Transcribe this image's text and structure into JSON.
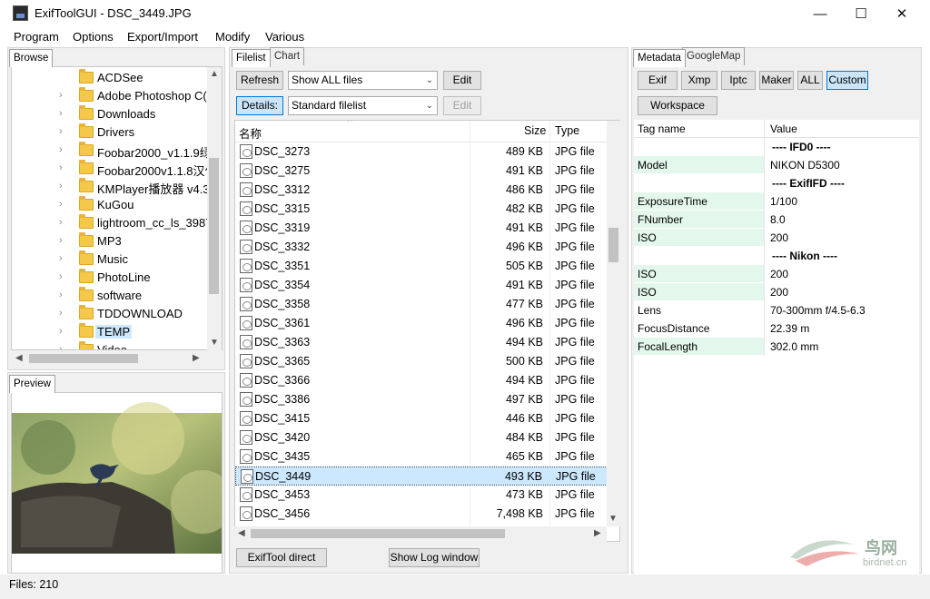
{
  "window": {
    "title": "ExifToolGUI - DSC_3449.JPG",
    "minimize": "—",
    "maximize": "☐",
    "close": "✕"
  },
  "menu": [
    "Program",
    "Options",
    "Export/Import",
    "Modify",
    "Various"
  ],
  "left": {
    "browse_tab": "Browse",
    "preview_tab": "Preview",
    "folders": [
      {
        "name": "ACDSee",
        "expander": false
      },
      {
        "name": "Adobe Photoshop C(",
        "expander": true
      },
      {
        "name": "Downloads",
        "expander": true
      },
      {
        "name": "Drivers",
        "expander": true
      },
      {
        "name": "Foobar2000_v1.1.9绿",
        "expander": true
      },
      {
        "name": "Foobar2000v1.1.8汉化",
        "expander": true
      },
      {
        "name": "KMPlayer播放器 v4.3.",
        "expander": true
      },
      {
        "name": "KuGou",
        "expander": true
      },
      {
        "name": "lightroom_cc_ls_3987",
        "expander": true
      },
      {
        "name": "MP3",
        "expander": true
      },
      {
        "name": "Music",
        "expander": true
      },
      {
        "name": "PhotoLine",
        "expander": true
      },
      {
        "name": "software",
        "expander": true
      },
      {
        "name": "TDDOWNLOAD",
        "expander": true
      },
      {
        "name": "TEMP",
        "expander": true,
        "selected": true
      },
      {
        "name": "Video",
        "expander": true
      }
    ]
  },
  "center": {
    "tabs": [
      "Filelist",
      "Chart"
    ],
    "refresh": "Refresh",
    "filter": "Show ALL files",
    "edit1": "Edit",
    "details": "Details:",
    "view": "Standard filelist",
    "edit2": "Edit",
    "columns": {
      "name": "名称",
      "size": "Size",
      "type": "Type"
    },
    "files": [
      {
        "name": "DSC_3273",
        "size": "489 KB",
        "type": "JPG file"
      },
      {
        "name": "DSC_3275",
        "size": "491 KB",
        "type": "JPG file"
      },
      {
        "name": "DSC_3312",
        "size": "486 KB",
        "type": "JPG file"
      },
      {
        "name": "DSC_3315",
        "size": "482 KB",
        "type": "JPG file"
      },
      {
        "name": "DSC_3319",
        "size": "491 KB",
        "type": "JPG file"
      },
      {
        "name": "DSC_3332",
        "size": "496 KB",
        "type": "JPG file"
      },
      {
        "name": "DSC_3351",
        "size": "505 KB",
        "type": "JPG file"
      },
      {
        "name": "DSC_3354",
        "size": "491 KB",
        "type": "JPG file"
      },
      {
        "name": "DSC_3358",
        "size": "477 KB",
        "type": "JPG file"
      },
      {
        "name": "DSC_3361",
        "size": "496 KB",
        "type": "JPG file"
      },
      {
        "name": "DSC_3363",
        "size": "494 KB",
        "type": "JPG file"
      },
      {
        "name": "DSC_3365",
        "size": "500 KB",
        "type": "JPG file"
      },
      {
        "name": "DSC_3366",
        "size": "494 KB",
        "type": "JPG file"
      },
      {
        "name": "DSC_3386",
        "size": "497 KB",
        "type": "JPG file"
      },
      {
        "name": "DSC_3415",
        "size": "446 KB",
        "type": "JPG file"
      },
      {
        "name": "DSC_3420",
        "size": "484 KB",
        "type": "JPG file"
      },
      {
        "name": "DSC_3435",
        "size": "465 KB",
        "type": "JPG file"
      },
      {
        "name": "DSC_3449",
        "size": "493 KB",
        "type": "JPG file",
        "selected": true
      },
      {
        "name": "DSC_3453",
        "size": "473 KB",
        "type": "JPG file"
      },
      {
        "name": "DSC_3456",
        "size": "7,498 KB",
        "type": "JPG file"
      }
    ],
    "exiftool_direct": "ExifTool direct",
    "show_log": "Show Log window"
  },
  "right": {
    "tabs": [
      "Metadata",
      "GoogleMap"
    ],
    "buttons": [
      "Exif",
      "Xmp",
      "Iptc",
      "Maker",
      "ALL",
      "Custom"
    ],
    "active_button": "Custom",
    "workspace": "Workspace",
    "header": {
      "tag": "Tag name",
      "value": "Value"
    },
    "rows": [
      {
        "tag": "",
        "value": "---- IFD0 ----",
        "group": true
      },
      {
        "tag": "Model",
        "value": "NIKON D5300",
        "hl": true
      },
      {
        "tag": "",
        "value": "---- ExifIFD ----",
        "group": true
      },
      {
        "tag": "ExposureTime",
        "value": "1/100",
        "hl": true
      },
      {
        "tag": "FNumber",
        "value": "8.0",
        "hl": true
      },
      {
        "tag": "ISO",
        "value": "200",
        "hl": true
      },
      {
        "tag": "",
        "value": "---- Nikon ----",
        "group": true
      },
      {
        "tag": "ISO",
        "value": "200",
        "hl": true
      },
      {
        "tag": "ISO",
        "value": "200",
        "hl": true
      },
      {
        "tag": "Lens",
        "value": "70-300mm f/4.5-6.3",
        "hl": false
      },
      {
        "tag": "FocusDistance",
        "value": "22.39 m",
        "hl": false
      },
      {
        "tag": "FocalLength",
        "value": "302.0 mm",
        "hl": true
      }
    ]
  },
  "watermark": {
    "brand": "鸟网",
    "url": "birdnet.cn"
  },
  "status": {
    "files": "Files: 210"
  },
  "colors": {
    "selection": "#cce8ff",
    "accent": "#0078d7",
    "tag_highlight": "#e4f7ec"
  }
}
